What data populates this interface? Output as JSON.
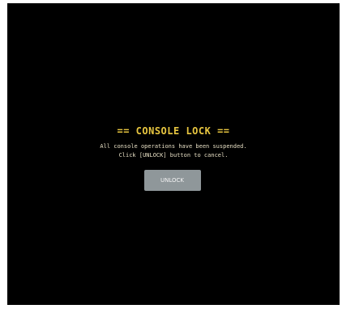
{
  "lock_screen": {
    "title": "== CONSOLE LOCK ==",
    "message_line1": "All console operations have been suspended.",
    "message_line2": "Click [UNLOCK] button to cancel.",
    "unlock_label": "UNLOCK"
  },
  "colors": {
    "background": "#000000",
    "title": "#e8c640",
    "message": "#e7dfc4",
    "button": "#8f979a"
  }
}
